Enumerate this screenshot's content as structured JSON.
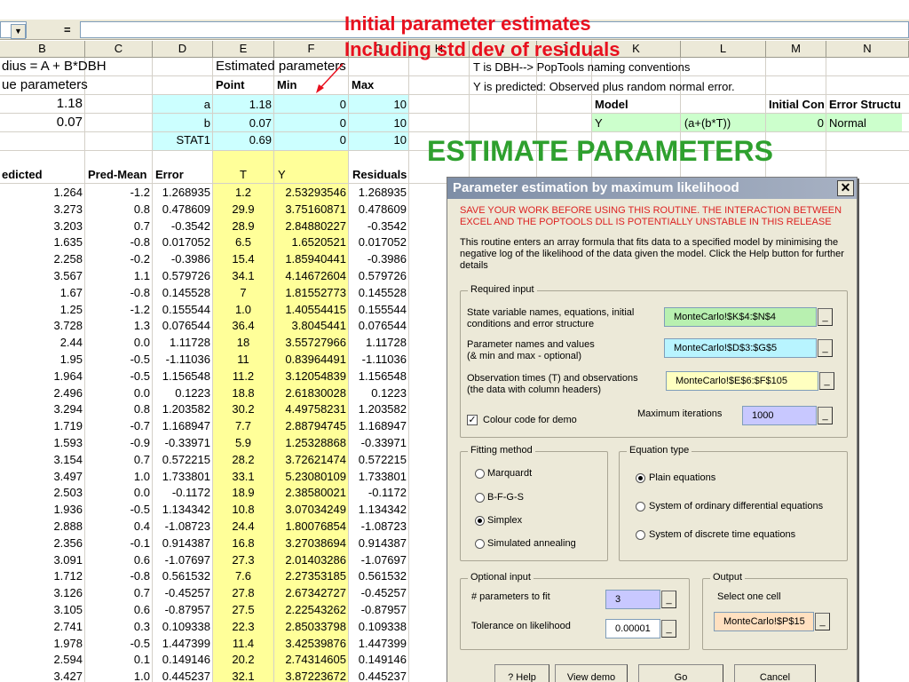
{
  "formula_bar": {
    "eq": "="
  },
  "columns": [
    {
      "label": "B"
    },
    {
      "label": "C"
    },
    {
      "label": "D"
    },
    {
      "label": "E"
    },
    {
      "label": "F"
    },
    {
      "label": "G"
    },
    {
      "label": "H"
    },
    {
      "label": "I"
    },
    {
      "label": "J"
    },
    {
      "label": "K"
    },
    {
      "label": "L"
    },
    {
      "label": "M"
    },
    {
      "label": "N"
    }
  ],
  "annotations": {
    "line1": "Initial parameter estimates",
    "line2": "Including std dev of residuals",
    "headline": "ESTIMATE PARAMETERS",
    "colors": {
      "annotation": "#e8101e",
      "headline": "#2ea02e"
    }
  },
  "sheet": {
    "title_formula": "dius = A + B*DBH",
    "values_header": "ue parameters",
    "value_a": "1.18",
    "value_b": "0.07",
    "est_header": "Estimated parameters",
    "col_point": "Point",
    "col_min": "Min",
    "col_max": "Max",
    "params": [
      {
        "name": "a",
        "point": "1.18",
        "min": "0",
        "max": "10"
      },
      {
        "name": "b",
        "point": "0.07",
        "min": "0",
        "max": "10"
      },
      {
        "name": "STAT1",
        "point": "0.69",
        "min": "0",
        "max": "10"
      }
    ],
    "note1": "T is DBH--> PopTools naming conventions",
    "note2": "Y is predicted: Observed plus random normal error.",
    "model_hdr": {
      "model": "Model",
      "initial": "Initial Con",
      "error": "Error Structu"
    },
    "model_row": {
      "var": "Y",
      "eq": "(a+(b*T))",
      "init": "0",
      "err": "Normal"
    },
    "data_headers": {
      "predicted": "edicted",
      "pred_mean": "Pred-Mean",
      "error": "Error",
      "t": "T",
      "y": "Y",
      "residuals": "Residuals"
    },
    "fill_colors": {
      "cyan": "#ccffff",
      "yellow": "#ffff99",
      "green": "#ccffcc"
    },
    "rows": [
      [
        "1.264",
        "-1.2",
        "1.268935",
        "1.2",
        "2.53293546",
        "1.268935"
      ],
      [
        "3.273",
        "0.8",
        "0.478609",
        "29.9",
        "3.75160871",
        "0.478609"
      ],
      [
        "3.203",
        "0.7",
        "-0.3542",
        "28.9",
        "2.84880227",
        "-0.3542"
      ],
      [
        "1.635",
        "-0.8",
        "0.017052",
        "6.5",
        "1.6520521",
        "0.017052"
      ],
      [
        "2.258",
        "-0.2",
        "-0.3986",
        "15.4",
        "1.85940441",
        "-0.3986"
      ],
      [
        "3.567",
        "1.1",
        "0.579726",
        "34.1",
        "4.14672604",
        "0.579726"
      ],
      [
        "1.67",
        "-0.8",
        "0.145528",
        "7",
        "1.81552773",
        "0.145528"
      ],
      [
        "1.25",
        "-1.2",
        "0.155544",
        "1.0",
        "1.40554415",
        "0.155544"
      ],
      [
        "3.728",
        "1.3",
        "0.076544",
        "36.4",
        "3.8045441",
        "0.076544"
      ],
      [
        "2.44",
        "0.0",
        "1.11728",
        "18",
        "3.55727966",
        "1.11728"
      ],
      [
        "1.95",
        "-0.5",
        "-1.11036",
        "11",
        "0.83964491",
        "-1.11036"
      ],
      [
        "1.964",
        "-0.5",
        "1.156548",
        "11.2",
        "3.12054839",
        "1.156548"
      ],
      [
        "2.496",
        "0.0",
        "0.1223",
        "18.8",
        "2.61830028",
        "0.1223"
      ],
      [
        "3.294",
        "0.8",
        "1.203582",
        "30.2",
        "4.49758231",
        "1.203582"
      ],
      [
        "1.719",
        "-0.7",
        "1.168947",
        "7.7",
        "2.88794745",
        "1.168947"
      ],
      [
        "1.593",
        "-0.9",
        "-0.33971",
        "5.9",
        "1.25328868",
        "-0.33971"
      ],
      [
        "3.154",
        "0.7",
        "0.572215",
        "28.2",
        "3.72621474",
        "0.572215"
      ],
      [
        "3.497",
        "1.0",
        "1.733801",
        "33.1",
        "5.23080109",
        "1.733801"
      ],
      [
        "2.503",
        "0.0",
        "-0.1172",
        "18.9",
        "2.38580021",
        "-0.1172"
      ],
      [
        "1.936",
        "-0.5",
        "1.134342",
        "10.8",
        "3.07034249",
        "1.134342"
      ],
      [
        "2.888",
        "0.4",
        "-1.08723",
        "24.4",
        "1.80076854",
        "-1.08723"
      ],
      [
        "2.356",
        "-0.1",
        "0.914387",
        "16.8",
        "3.27038694",
        "0.914387"
      ],
      [
        "3.091",
        "0.6",
        "-1.07697",
        "27.3",
        "2.01403286",
        "-1.07697"
      ],
      [
        "1.712",
        "-0.8",
        "0.561532",
        "7.6",
        "2.27353185",
        "0.561532"
      ],
      [
        "3.126",
        "0.7",
        "-0.45257",
        "27.8",
        "2.67342727",
        "-0.45257"
      ],
      [
        "3.105",
        "0.6",
        "-0.87957",
        "27.5",
        "2.22543262",
        "-0.87957"
      ],
      [
        "2.741",
        "0.3",
        "0.109338",
        "22.3",
        "2.85033798",
        "0.109338"
      ],
      [
        "1.978",
        "-0.5",
        "1.447399",
        "11.4",
        "3.42539876",
        "1.447399"
      ],
      [
        "2.594",
        "0.1",
        "0.149146",
        "20.2",
        "2.74314605",
        "0.149146"
      ],
      [
        "3.427",
        "1.0",
        "0.445237",
        "32.1",
        "3.87223672",
        "0.445237"
      ]
    ]
  },
  "dialog": {
    "title": "Parameter estimation by maximum likelihood",
    "close": "✕",
    "warning": "SAVE YOUR WORK BEFORE USING THIS ROUTINE. THE INTERACTION BETWEEN EXCEL AND THE POPTOOLS DLL IS POTENTIALLY UNSTABLE IN THIS RELEASE",
    "description": "This routine enters an array formula that fits data to a specified model by minimising the negative log of the likelihood of the data given the model. Click the Help button for further details",
    "required": {
      "title": "Required input",
      "state_label": "State variable names, equations, initial conditions and error structure",
      "state_value": "MonteCarlo!$K$4:$N$4",
      "param_label": "Parameter names and values\n (& min and max - optional)",
      "param_value": "MonteCarlo!$D$3:$G$5",
      "obs_label": "Observation times (T) and observations (the data with column headers)",
      "obs_value": "MonteCarlo!$E$6:$F$105",
      "colour_label": "Colour code for demo",
      "colour_checked": "✓",
      "maxiter_label": "Maximum iterations",
      "maxiter_value": "1000",
      "ref_btn": "_"
    },
    "fitting": {
      "title": "Fitting method",
      "options": [
        "Marquardt",
        "B-F-G-S",
        "Simplex",
        "Simulated annealing"
      ],
      "selected": "Simplex"
    },
    "equation": {
      "title": "Equation type",
      "options": [
        "Plain equations",
        "System of ordinary differential equations",
        "System of discrete time equations"
      ],
      "selected": "Plain equations"
    },
    "optional": {
      "title": "Optional input",
      "nparams_label": "# parameters to fit",
      "nparams_value": "3",
      "tol_label": "Tolerance on likelihood",
      "tol_value": "0.00001"
    },
    "output": {
      "title": "Output",
      "label": "Select one cell",
      "value": "MonteCarlo!$P$15"
    },
    "buttons": {
      "help": "? Help",
      "demo": "View demo",
      "go": "Go",
      "cancel": "Cancel"
    },
    "colors": {
      "green": "#b8f0b0",
      "cyan": "#b8f4ff",
      "yellow": "#ffffc0",
      "lavender": "#c8c8ff",
      "peach": "#ffe0c0"
    }
  }
}
